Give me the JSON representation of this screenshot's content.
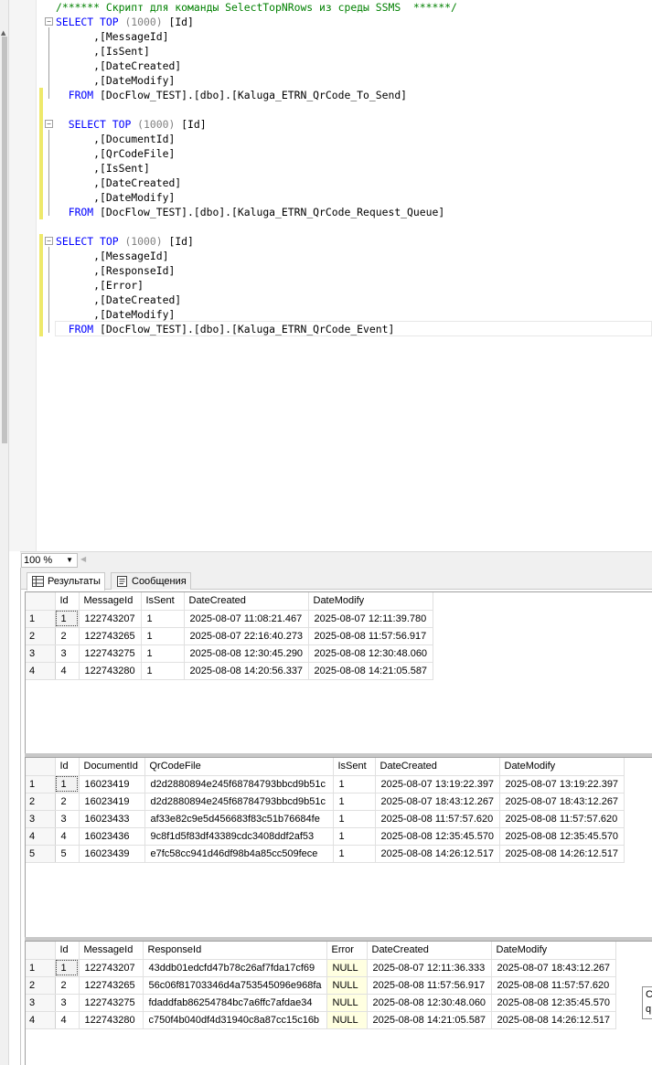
{
  "editor": {
    "zoom": "100 %",
    "comment": "/****** Скрипт для команды SelectTopNRows из среды SSMS  ******/",
    "queries": [
      {
        "select_kw": "SELECT",
        "top_kw": "TOP",
        "top_n": "(1000)",
        "first_col": "[Id]",
        "columns": [
          ",[MessageId]",
          ",[IsSent]",
          ",[DateCreated]",
          ",[DateModify]"
        ],
        "from_kw": "FROM",
        "table": "[DocFlow_TEST].[dbo].[Kaluga_ETRN_QrCode_To_Send]"
      },
      {
        "select_kw": "SELECT",
        "top_kw": "TOP",
        "top_n": "(1000)",
        "first_col": "[Id]",
        "columns": [
          ",[DocumentId]",
          ",[QrCodeFile]",
          ",[IsSent]",
          ",[DateCreated]",
          ",[DateModify]"
        ],
        "from_kw": "FROM",
        "table": "[DocFlow_TEST].[dbo].[Kaluga_ETRN_QrCode_Request_Queue]"
      },
      {
        "select_kw": "SELECT",
        "top_kw": "TOP",
        "top_n": "(1000)",
        "first_col": "[Id]",
        "columns": [
          ",[MessageId]",
          ",[ResponseId]",
          ",[Error]",
          ",[DateCreated]",
          ",[DateModify]"
        ],
        "from_kw": "FROM",
        "table": "[DocFlow_TEST].[dbo].[Kaluga_ETRN_QrCode_Event]"
      }
    ]
  },
  "results": {
    "tabs": [
      {
        "label": "Результаты",
        "icon": "grid-icon"
      },
      {
        "label": "Сообщения",
        "icon": "messages-icon"
      }
    ],
    "grids": [
      {
        "headers": [
          "Id",
          "MessageId",
          "IsSent",
          "DateCreated",
          "DateModify"
        ],
        "rows": [
          [
            "1",
            "1",
            "122743207",
            "1",
            "2025-08-07 11:08:21.467",
            "2025-08-07 12:11:39.780"
          ],
          [
            "2",
            "2",
            "122743265",
            "1",
            "2025-08-07 22:16:40.273",
            "2025-08-08 11:57:56.917"
          ],
          [
            "3",
            "3",
            "122743275",
            "1",
            "2025-08-08 12:30:45.290",
            "2025-08-08 12:30:48.060"
          ],
          [
            "4",
            "4",
            "122743280",
            "1",
            "2025-08-08 14:20:56.337",
            "2025-08-08 14:21:05.587"
          ]
        ]
      },
      {
        "headers": [
          "Id",
          "DocumentId",
          "QrCodeFile",
          "IsSent",
          "DateCreated",
          "DateModify"
        ],
        "rows": [
          [
            "1",
            "1",
            "16023419",
            "d2d2880894e245f68784793bbcd9b51c",
            "1",
            "2025-08-07 13:19:22.397",
            "2025-08-07 13:19:22.397"
          ],
          [
            "2",
            "2",
            "16023419",
            "d2d2880894e245f68784793bbcd9b51c",
            "1",
            "2025-08-07 18:43:12.267",
            "2025-08-07 18:43:12.267"
          ],
          [
            "3",
            "3",
            "16023433",
            "af33e82c9e5d456683f83c51b76684fe",
            "1",
            "2025-08-08 11:57:57.620",
            "2025-08-08 11:57:57.620"
          ],
          [
            "4",
            "4",
            "16023436",
            "9c8f1d5f83df43389cdc3408ddf2af53",
            "1",
            "2025-08-08 12:35:45.570",
            "2025-08-08 12:35:45.570"
          ],
          [
            "5",
            "5",
            "16023439",
            "e7fc58cc941d46df98b4a85cc509fece",
            "1",
            "2025-08-08 14:26:12.517",
            "2025-08-08 14:26:12.517"
          ]
        ]
      },
      {
        "headers": [
          "Id",
          "MessageId",
          "ResponseId",
          "Error",
          "DateCreated",
          "DateModify"
        ],
        "rows": [
          [
            "1",
            "1",
            "122743207",
            "43ddb01edcfd47b78c26af7fda17cf69",
            "NULL",
            "2025-08-07 12:11:36.333",
            "2025-08-07 18:43:12.267"
          ],
          [
            "2",
            "2",
            "122743265",
            "56c06f81703346d4a753545096e968fa",
            "NULL",
            "2025-08-08 11:57:56.917",
            "2025-08-08 11:57:57.620"
          ],
          [
            "3",
            "3",
            "122743275",
            "fdaddfab86254784bc7a6ffc7afdae34",
            "NULL",
            "2025-08-08 12:30:48.060",
            "2025-08-08 12:35:45.570"
          ],
          [
            "4",
            "4",
            "122743280",
            "c750f4b040df4d31940c8a87cc15c16b",
            "NULL",
            "2025-08-08 14:21:05.587",
            "2025-08-08 14:26:12.517"
          ]
        ]
      }
    ],
    "tooltip_fragment": "С\nq"
  }
}
